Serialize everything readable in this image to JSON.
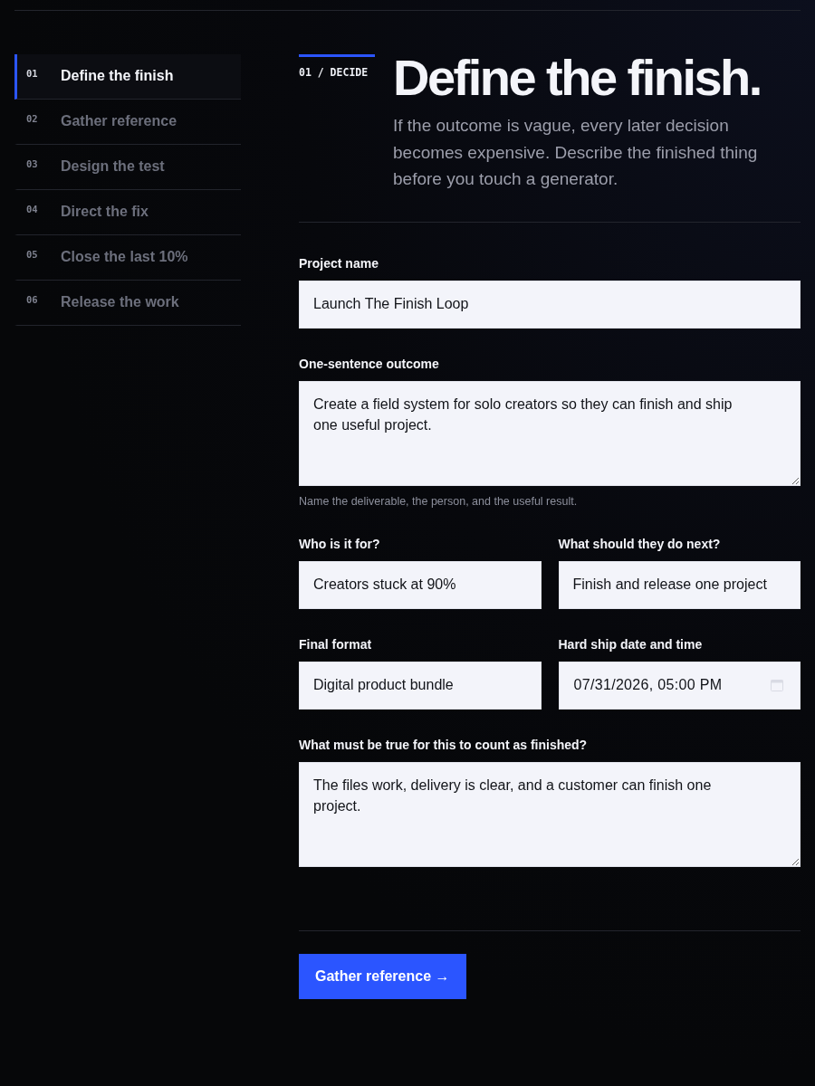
{
  "nav": {
    "items": [
      {
        "number": "01",
        "label": "Define the finish",
        "selected": true
      },
      {
        "number": "02",
        "label": "Gather reference",
        "selected": false
      },
      {
        "number": "03",
        "label": "Design the test",
        "selected": false
      },
      {
        "number": "04",
        "label": "Direct the fix",
        "selected": false
      },
      {
        "number": "05",
        "label": "Close the last 10%",
        "selected": false
      },
      {
        "number": "06",
        "label": "Release the work",
        "selected": false
      }
    ]
  },
  "header": {
    "step": "01 / DECIDE",
    "title": "Define the finish.",
    "intro": "If the outcome is vague, every later decision becomes expensive. Describe the finished thing before you touch a generator."
  },
  "form": {
    "rows": [
      {
        "fields": [
          {
            "kind": "text",
            "label": "Project name",
            "value": "Launch The Finish Loop"
          }
        ]
      },
      {
        "fields": [
          {
            "kind": "textarea",
            "label": "One-sentence outcome",
            "value": "Create a field system for solo creators so they can finish and ship one useful project.",
            "hint": "Name the deliverable, the person, and the useful result."
          }
        ]
      },
      {
        "fields": [
          {
            "kind": "text",
            "label": "Who is it for?",
            "value": "Creators stuck at 90%"
          },
          {
            "kind": "text",
            "label": "What should they do next?",
            "value": "Finish and release one project"
          }
        ]
      },
      {
        "fields": [
          {
            "kind": "text",
            "label": "Final format",
            "value": "Digital product bundle"
          },
          {
            "kind": "datetime",
            "label": "Hard ship date and time",
            "value": "07/31/2026, 05:00 PM"
          }
        ]
      },
      {
        "fields": [
          {
            "kind": "textarea",
            "label": "What must be true for this to count as finished?",
            "value": "The files work, delivery is clear, and a customer can finish one project."
          }
        ]
      }
    ]
  },
  "next_button": {
    "label": "Gather reference →"
  }
}
